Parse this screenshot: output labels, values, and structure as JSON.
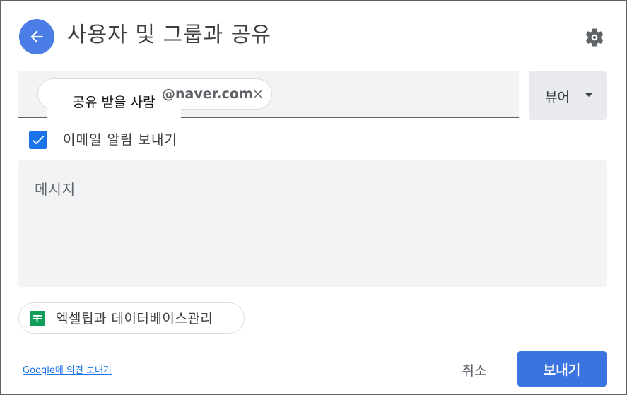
{
  "dialog": {
    "title": "사용자 및 그룹과 공유",
    "back_icon": "arrow-left-icon",
    "settings_icon": "gear-icon"
  },
  "recipient": {
    "chip_label": "공유 받을 사람",
    "chip_email": "@naver.com",
    "remove_icon": "close-icon"
  },
  "role": {
    "selected": "뷰어",
    "caret_icon": "caret-down-icon"
  },
  "notify": {
    "checked": true,
    "label": "이메일 알림 보내기"
  },
  "message": {
    "placeholder": "메시지"
  },
  "attachment": {
    "icon": "google-sheets-icon",
    "name": "엑셀팁과 데이터베이스관리"
  },
  "footer": {
    "feedback_link": "Google에 의견 보내기",
    "cancel_label": "취소",
    "send_label": "보내기"
  },
  "colors": {
    "accent": "#3b73e0",
    "checkbox": "#1a73e8",
    "sheets_green": "#0f9d58",
    "field_bg": "#f1f3f4"
  }
}
